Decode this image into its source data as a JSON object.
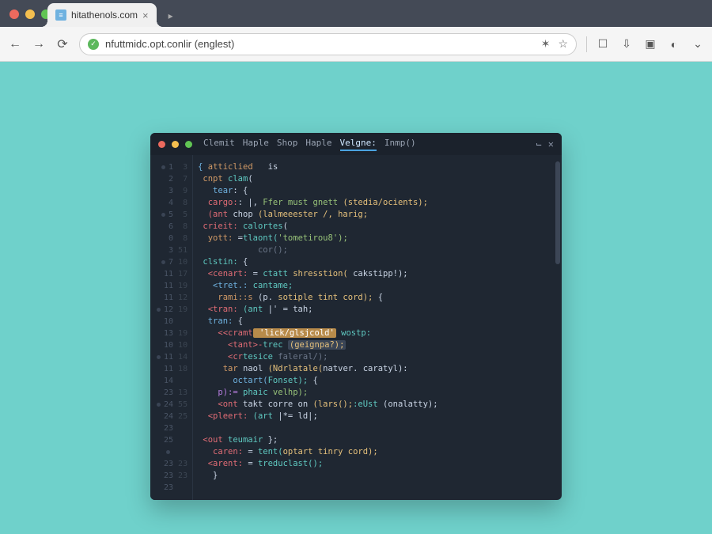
{
  "browser": {
    "tab_title": "hitathenols.com",
    "url": "nfuttmidc.opt.conlir (englest)",
    "toolbar_icons": [
      "user",
      "download",
      "briefcase",
      "circle",
      "mic"
    ]
  },
  "editor": {
    "menu": [
      "Clemit",
      "Haple",
      "Shop",
      "Haple",
      "Velgne:",
      "Inmp()"
    ],
    "gutter_a": [
      "1",
      "2",
      "3",
      "4",
      "5",
      "6",
      "0",
      "3",
      "7",
      "11",
      "11",
      "11",
      "12",
      "10",
      "13",
      "10",
      "11",
      "11",
      "14",
      "23",
      "24",
      "24",
      "23",
      "25",
      "",
      "23",
      "23",
      "23"
    ],
    "gutter_b": [
      "3",
      "7",
      "9",
      "8",
      "5",
      "8",
      "8",
      "51",
      "10",
      "17",
      "19",
      "12",
      "19",
      "",
      "19",
      "10",
      "14",
      "18",
      "",
      "13",
      "55",
      "25",
      "",
      "",
      "",
      "23",
      "23",
      ""
    ],
    "lines": [
      {
        "i": 0,
        "segs": [
          {
            "c": "k-blue",
            "t": "{ "
          },
          {
            "c": "k-orange",
            "t": "atticlied"
          },
          {
            "c": "",
            "t": "   is"
          }
        ]
      },
      {
        "i": 1,
        "segs": [
          {
            "c": "k-orange",
            "t": " cnpt"
          },
          {
            "c": "k-teal",
            "t": " clam"
          },
          {
            "c": "",
            "t": "("
          }
        ]
      },
      {
        "i": 2,
        "segs": [
          {
            "c": "k-blue",
            "t": "   tear"
          },
          {
            "c": "",
            "t": ": {"
          }
        ]
      },
      {
        "i": 3,
        "segs": [
          {
            "c": "k-red",
            "t": "  cargo:"
          },
          {
            "c": "",
            "t": ": |,"
          },
          {
            "c": "k-green",
            "t": " Ffer must gnett"
          },
          {
            "c": "k-yellow",
            "t": " (stedia/ocients);"
          }
        ]
      },
      {
        "i": 4,
        "segs": [
          {
            "c": "k-red",
            "t": "  (ant"
          },
          {
            "c": "",
            "t": " chop "
          },
          {
            "c": "k-yellow",
            "t": "(lalmeeester /, harig;"
          }
        ]
      },
      {
        "i": 5,
        "segs": [
          {
            "c": "k-red",
            "t": " crieit:"
          },
          {
            "c": "k-teal",
            "t": " calortes"
          },
          {
            "c": "",
            "t": "("
          }
        ]
      },
      {
        "i": 6,
        "segs": [
          {
            "c": "k-orange",
            "t": "  yott:"
          },
          {
            "c": "",
            "t": " ="
          },
          {
            "c": "k-teal",
            "t": "tlaont("
          },
          {
            "c": "k-green",
            "t": "'tometirou8');"
          }
        ]
      },
      {
        "i": 7,
        "segs": [
          {
            "c": "k-gray",
            "t": "            cor();"
          }
        ]
      },
      {
        "i": 8,
        "segs": [
          {
            "c": "k-teal",
            "t": " clstin:"
          },
          {
            "c": "",
            "t": " {"
          }
        ]
      },
      {
        "i": 9,
        "segs": [
          {
            "c": "k-red",
            "t": "  <cenart:"
          },
          {
            "c": "",
            "t": " = "
          },
          {
            "c": "k-teal",
            "t": "ctatt"
          },
          {
            "c": "k-yellow",
            "t": " shresstion("
          },
          {
            "c": "",
            "t": " cakstipp!);"
          }
        ]
      },
      {
        "i": 10,
        "segs": [
          {
            "c": "k-blue",
            "t": "   <tret.:"
          },
          {
            "c": "k-teal",
            "t": " cantame;"
          }
        ]
      },
      {
        "i": 11,
        "segs": [
          {
            "c": "k-orange",
            "t": "    rami::s"
          },
          {
            "c": "",
            "t": " (p. "
          },
          {
            "c": "k-yellow",
            "t": "sotiple tint cord); "
          },
          {
            "c": "",
            "t": "{"
          }
        ]
      },
      {
        "i": 12,
        "segs": [
          {
            "c": "k-red",
            "t": "  <tran:"
          },
          {
            "c": "k-teal",
            "t": " (ant"
          },
          {
            "c": "",
            "t": " |' = tah;"
          }
        ]
      },
      {
        "i": 13,
        "segs": [
          {
            "c": "k-blue",
            "t": "  tran:"
          },
          {
            "c": "",
            "t": " {"
          }
        ]
      },
      {
        "i": 14,
        "segs": [
          {
            "c": "k-red",
            "t": "    <<cramt"
          },
          {
            "c": "hl",
            "t": " 'lick/glsjcold'"
          },
          {
            "c": "k-teal",
            "t": " wostp:"
          }
        ]
      },
      {
        "i": 15,
        "segs": [
          {
            "c": "k-red",
            "t": "      <tant>-"
          },
          {
            "c": "k-teal",
            "t": "trec "
          },
          {
            "c": "hl2 k-yellow",
            "t": "(geignpa?);"
          }
        ]
      },
      {
        "i": 16,
        "segs": [
          {
            "c": "k-red",
            "t": "      <cr"
          },
          {
            "c": "k-teal",
            "t": "tesice"
          },
          {
            "c": "k-gray",
            "t": " faleral/);"
          }
        ]
      },
      {
        "i": 17,
        "segs": [
          {
            "c": "k-orange",
            "t": "     tar"
          },
          {
            "c": "",
            "t": " naol "
          },
          {
            "c": "k-yellow",
            "t": "(Ndrlatale("
          },
          {
            "c": "",
            "t": "natver. caratyl):"
          }
        ]
      },
      {
        "i": 18,
        "segs": [
          {
            "c": "k-blue",
            "t": "       octart("
          },
          {
            "c": "k-teal",
            "t": "Fonset);"
          },
          {
            "c": "",
            "t": " {"
          }
        ]
      },
      {
        "i": 19,
        "segs": [
          {
            "c": "k-purple",
            "t": "    p):="
          },
          {
            "c": "k-teal",
            "t": " phaic"
          },
          {
            "c": "k-green",
            "t": " velhp);"
          }
        ]
      },
      {
        "i": 20,
        "segs": [
          {
            "c": "k-red",
            "t": "    <ont"
          },
          {
            "c": "",
            "t": " takt corre on "
          },
          {
            "c": "k-yellow",
            "t": "(lars();"
          },
          {
            "c": "k-teal",
            "t": ":eUst"
          },
          {
            "c": "",
            "t": " (onalatty);"
          }
        ]
      },
      {
        "i": 21,
        "segs": [
          {
            "c": "k-red",
            "t": "  <pleert:"
          },
          {
            "c": "k-teal",
            "t": " (art"
          },
          {
            "c": "",
            "t": " |*= ld|;"
          }
        ]
      },
      {
        "i": 22,
        "segs": [
          {
            "c": "",
            "t": ""
          }
        ]
      },
      {
        "i": 23,
        "segs": [
          {
            "c": "k-red",
            "t": " <out"
          },
          {
            "c": "k-teal",
            "t": " teumair"
          },
          {
            "c": "",
            "t": " };"
          }
        ]
      },
      {
        "i": 24,
        "segs": [
          {
            "c": "k-red",
            "t": "   caren:"
          },
          {
            "c": "",
            "t": " = "
          },
          {
            "c": "k-teal",
            "t": "tent("
          },
          {
            "c": "k-yellow",
            "t": "optart tinry cord);"
          }
        ]
      },
      {
        "i": 25,
        "segs": [
          {
            "c": "k-red",
            "t": "  <arent:"
          },
          {
            "c": "",
            "t": " = "
          },
          {
            "c": "k-teal",
            "t": "treduclast();"
          }
        ]
      },
      {
        "i": 26,
        "segs": [
          {
            "c": "",
            "t": "   }"
          }
        ]
      }
    ]
  }
}
